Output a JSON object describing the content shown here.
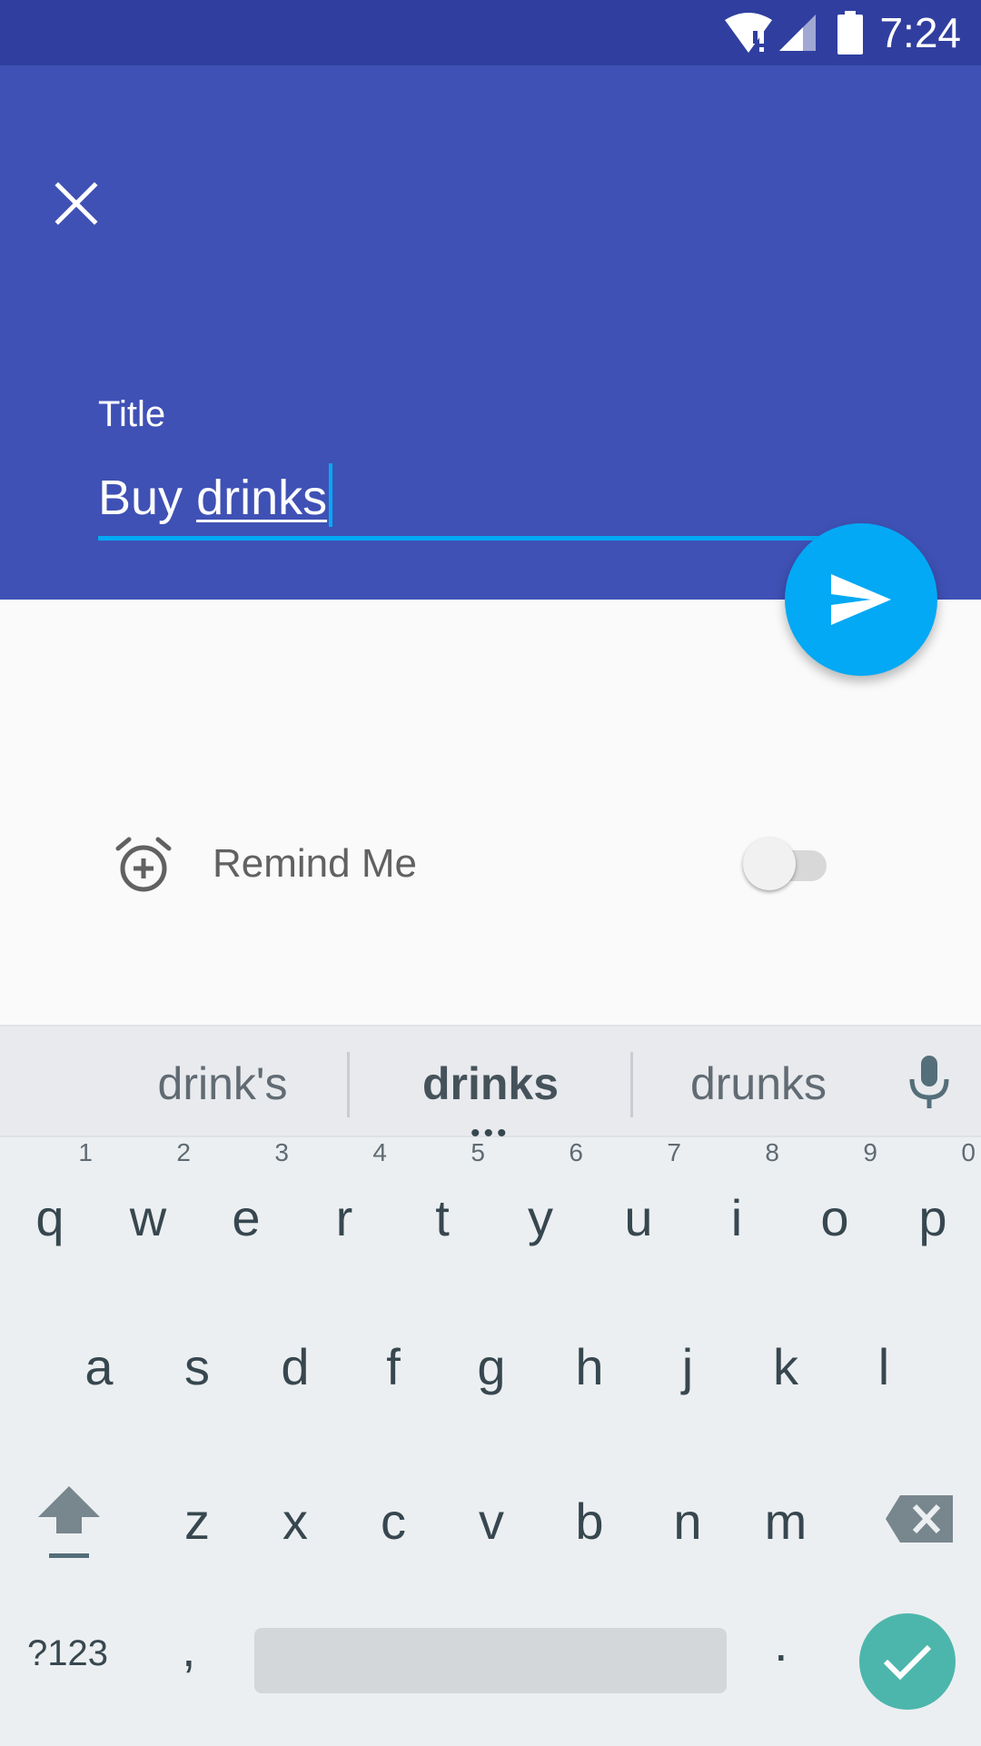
{
  "status_bar": {
    "time": "7:24",
    "icons": [
      "wifi-alert-icon",
      "signal-icon",
      "battery-icon"
    ]
  },
  "app_bar": {
    "close_icon": "close-icon",
    "title_label": "Title",
    "title_value_plain": "Buy ",
    "title_value_underlined": "drinks"
  },
  "fab": {
    "icon": "send-icon",
    "color": "#03a9f4"
  },
  "reminder": {
    "icon": "alarm-add-icon",
    "label": "Remind Me",
    "enabled": false
  },
  "keyboard": {
    "suggestions": [
      "drink's",
      "drinks",
      "drunks"
    ],
    "mic_icon": "mic-icon",
    "rows": {
      "row1": [
        "q",
        "w",
        "e",
        "r",
        "t",
        "y",
        "u",
        "i",
        "o",
        "p"
      ],
      "row1_hints": [
        "1",
        "2",
        "3",
        "4",
        "5",
        "6",
        "7",
        "8",
        "9",
        "0"
      ],
      "row2": [
        "a",
        "s",
        "d",
        "f",
        "g",
        "h",
        "j",
        "k",
        "l"
      ],
      "row3": [
        "z",
        "x",
        "c",
        "v",
        "b",
        "n",
        "m"
      ]
    },
    "symbols_key": "?123",
    "comma_key": ",",
    "period_key": ".",
    "shift_icon": "shift-icon",
    "backspace_icon": "backspace-icon",
    "done_icon": "check-icon",
    "colors": {
      "primary": "#3f51b5",
      "primary_dark": "#303f9f",
      "accent": "#03a9f4",
      "done": "#4db6ac"
    }
  }
}
